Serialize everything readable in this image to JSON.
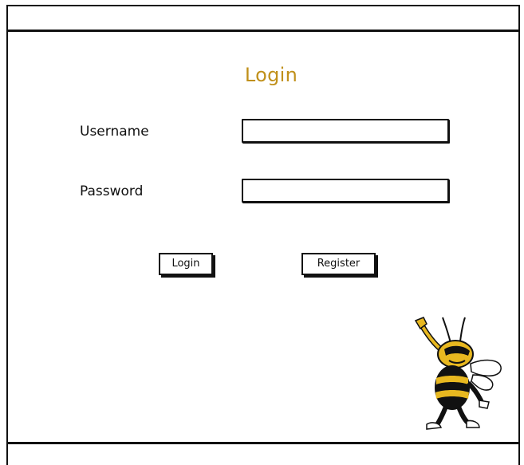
{
  "page": {
    "title": "Login"
  },
  "form": {
    "username_label": "Username",
    "password_label": "Password",
    "username_value": "",
    "password_value": "",
    "login_button": "Login",
    "register_button": "Register"
  },
  "mascot": {
    "icon": "bee-mascot-icon"
  },
  "colors": {
    "title": "#c0901a",
    "border": "#111111",
    "mascot_yellow": "#e8b820",
    "mascot_black": "#111111"
  }
}
